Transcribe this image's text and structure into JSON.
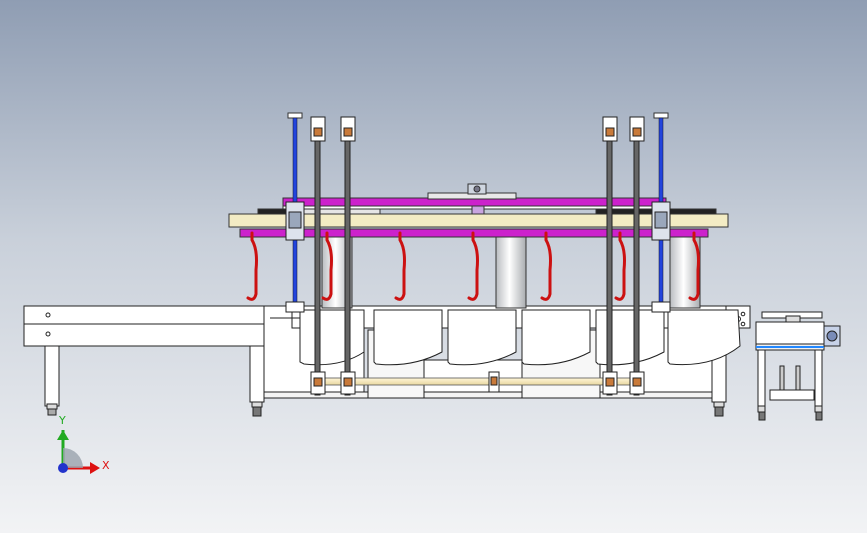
{
  "viewport": {
    "background_top": "#8f9db3",
    "background_bottom": "#f2f3f5"
  },
  "colors": {
    "frame_purple": "#cc22cc",
    "beam_cream": "#f3ecc4",
    "hook_red": "#cc1111",
    "guide_blue": "#2244dd",
    "outline": "#222222",
    "axis_x": "#dd1111",
    "axis_y": "#22aa22",
    "axis_origin": "#2233cc"
  },
  "triad": {
    "x_label": "X",
    "y_label": "Y"
  }
}
